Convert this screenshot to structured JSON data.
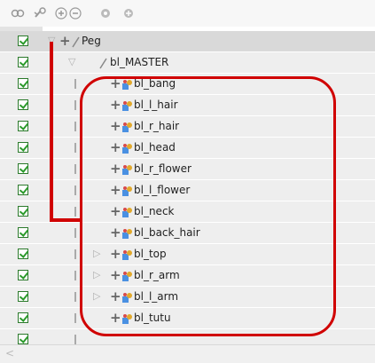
{
  "toolbar": {
    "icons": [
      "link-icon",
      "broken-link-icon",
      "add-icon",
      "remove-icon",
      "node-icon",
      "node-add-icon"
    ],
    "plus_glyph": "+",
    "minus_glyph": "−"
  },
  "tree": {
    "rows": [
      {
        "label": "Peg",
        "checked": true
      },
      {
        "label": "bl_MASTER",
        "checked": true
      },
      {
        "label": "bl_bang",
        "checked": true
      },
      {
        "label": "bl_l_hair",
        "checked": true
      },
      {
        "label": "bl_r_hair",
        "checked": true
      },
      {
        "label": "bl_head",
        "checked": true
      },
      {
        "label": "bl_r_flower",
        "checked": true
      },
      {
        "label": "bl_l_flower",
        "checked": true
      },
      {
        "label": "bl_neck",
        "checked": true
      },
      {
        "label": "bl_back_hair",
        "checked": true
      },
      {
        "label": "bl_top",
        "checked": true
      },
      {
        "label": "bl_r_arm",
        "checked": true
      },
      {
        "label": "bl_l_arm",
        "checked": true
      },
      {
        "label": "bl_tutu",
        "checked": true
      }
    ]
  },
  "colors": {
    "highlight": "#d00000",
    "check": "#2b9a2b"
  }
}
